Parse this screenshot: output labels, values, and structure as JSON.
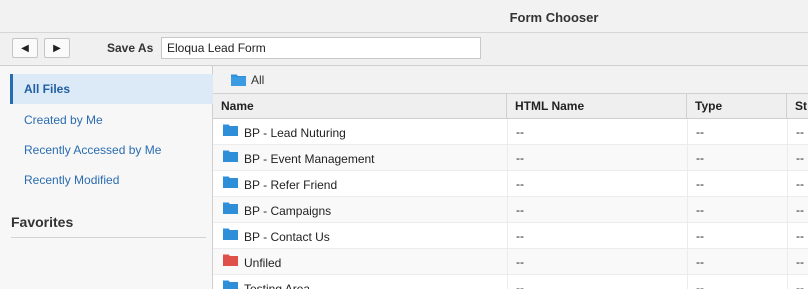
{
  "window": {
    "title": "Form Chooser"
  },
  "toolbar": {
    "back_glyph": "◀",
    "forward_glyph": "▶",
    "save_as_label": "Save As",
    "save_as_value": "Eloqua Lead Form"
  },
  "sidebar": {
    "items": [
      {
        "label": "All Files",
        "active": true
      },
      {
        "label": "Created by Me",
        "active": false
      },
      {
        "label": "Recently Accessed by Me",
        "active": false
      },
      {
        "label": "Recently Modified",
        "active": false
      }
    ],
    "favorites_heading": "Favorites"
  },
  "breadcrumb": {
    "label": "All"
  },
  "table": {
    "headers": {
      "name": "Name",
      "html_name": "HTML Name",
      "type": "Type",
      "status": "St"
    },
    "rows": [
      {
        "name": "BP - Lead Nuturing",
        "html_name": "--",
        "type": "--",
        "status": "--",
        "folder_color": "#2f8fd8"
      },
      {
        "name": "BP - Event Management",
        "html_name": "--",
        "type": "--",
        "status": "--",
        "folder_color": "#2f8fd8"
      },
      {
        "name": "BP - Refer Friend",
        "html_name": "--",
        "type": "--",
        "status": "--",
        "folder_color": "#2f8fd8"
      },
      {
        "name": "BP - Campaigns",
        "html_name": "--",
        "type": "--",
        "status": "--",
        "folder_color": "#2f8fd8"
      },
      {
        "name": "BP - Contact Us",
        "html_name": "--",
        "type": "--",
        "status": "--",
        "folder_color": "#2f8fd8"
      },
      {
        "name": "Unfiled",
        "html_name": "--",
        "type": "--",
        "status": "--",
        "folder_color": "#e0504a"
      },
      {
        "name": "Testing Area",
        "html_name": "--",
        "type": "--",
        "status": "--",
        "folder_color": "#2f8fd8"
      }
    ]
  },
  "colors": {
    "link": "#2a6cb0",
    "folder_blue": "#2f8fd8",
    "folder_red": "#e0504a"
  }
}
